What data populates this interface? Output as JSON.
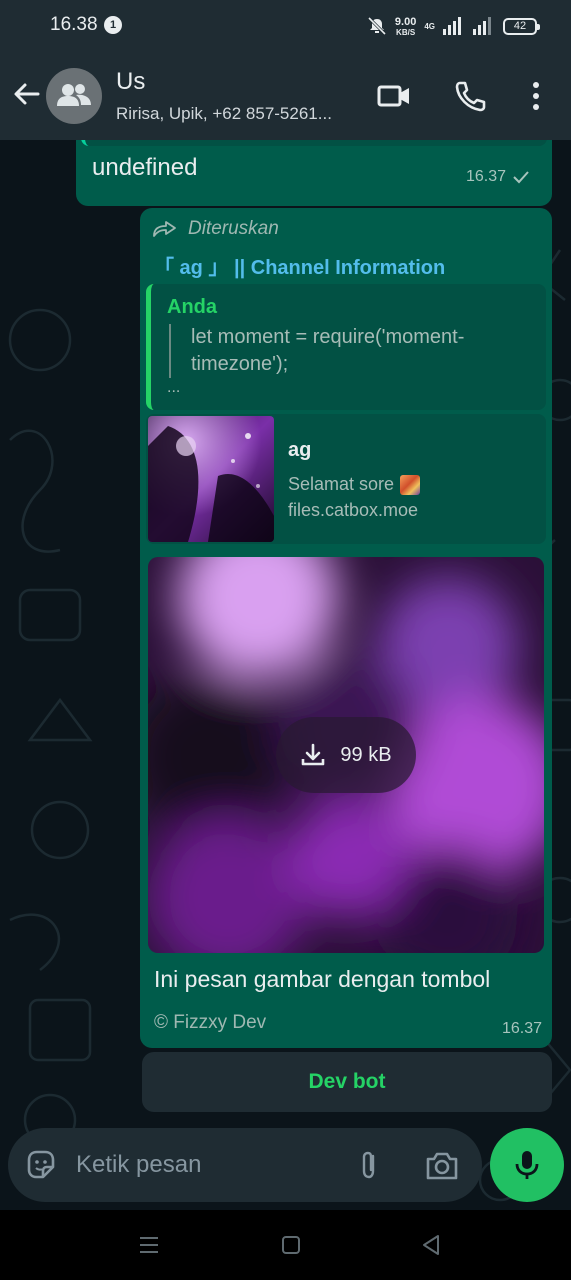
{
  "status_bar": {
    "time": "16.38",
    "notification_count": "1",
    "net_speed_top": "9.00",
    "net_speed_unit": "KB/S",
    "network_type": "4G",
    "battery": "42"
  },
  "header": {
    "title": "Us",
    "subtitle": "Ririsa, Upik, +62 857-5261..."
  },
  "messages": [
    {
      "quote_preview": "...",
      "text": "undefined",
      "time": "16.37"
    },
    {
      "forwarded_label": "Diteruskan",
      "channel_line": "「 ag 」 || Channel Information",
      "quote_author": "Anda",
      "quote_code": "let moment = require('moment-timezone');",
      "quote_ellipsis": "...",
      "link_preview": {
        "title": "ag",
        "description": "Selamat sore",
        "domain": "files.catbox.moe"
      },
      "media_size": "99 kB",
      "caption": "Ini pesan gambar dengan tombol",
      "footer": "© Fizzxy Dev",
      "time": "16.37"
    }
  ],
  "bot_button": {
    "label": "Dev bot"
  },
  "input": {
    "placeholder": "Ketik pesan"
  },
  "colors": {
    "header_bg": "#1f2c33",
    "chat_bg": "#0b141a",
    "outgoing_bubble": "#005c4b",
    "accent_green": "#25d366",
    "link_blue": "#53bdeb"
  },
  "icons": [
    "back-arrow-icon",
    "group-avatar-icon",
    "video-call-icon",
    "phone-icon",
    "more-vert-icon",
    "forward-icon",
    "download-icon",
    "sticker-icon",
    "attach-icon",
    "camera-icon",
    "mic-icon"
  ]
}
